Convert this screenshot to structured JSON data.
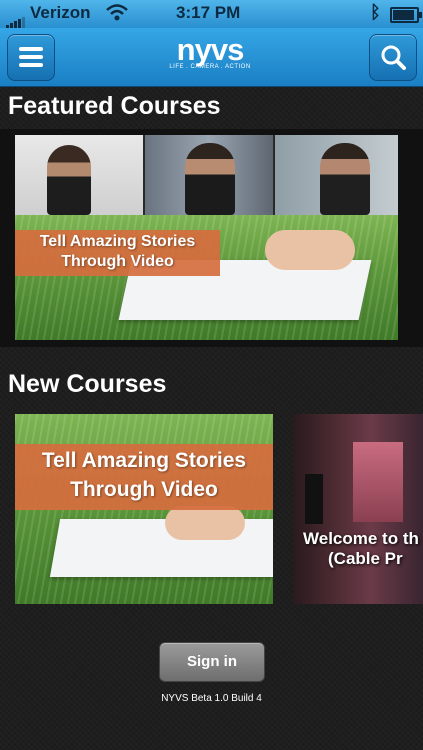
{
  "status_bar": {
    "carrier": "Verizon",
    "time": "3:17 PM"
  },
  "navbar": {
    "logo_text": "nyvs",
    "logo_tagline": "LIFE . CAMERA . ACTION"
  },
  "featured": {
    "heading": "Featured Courses",
    "items": [
      {
        "banner_line1": "Tell Amazing Stories",
        "banner_line2": "Through Video"
      }
    ]
  },
  "new_courses": {
    "heading": "New Courses",
    "items": [
      {
        "banner_line1": "Tell Amazing Stories",
        "banner_line2": "Through Video"
      },
      {
        "caption_line1": "Welcome to th",
        "caption_line2": "(Cable Pr"
      }
    ]
  },
  "footer": {
    "sign_in_label": "Sign in",
    "version": "NYVS Beta 1.0 Build 4"
  }
}
